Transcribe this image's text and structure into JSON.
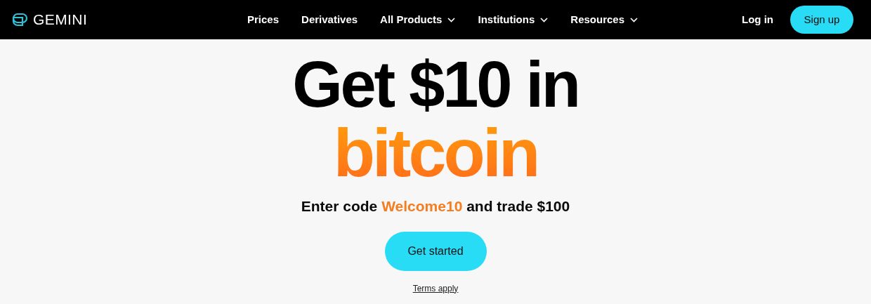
{
  "header": {
    "logo_text": "GEMINI",
    "nav": [
      {
        "label": "Prices",
        "has_menu": false
      },
      {
        "label": "Derivatives",
        "has_menu": false
      },
      {
        "label": "All Products",
        "has_menu": true
      },
      {
        "label": "Institutions",
        "has_menu": true
      },
      {
        "label": "Resources",
        "has_menu": true
      }
    ],
    "login": "Log in",
    "signup": "Sign up"
  },
  "hero": {
    "headline": "Get $10 in",
    "highlight": "bitcoin",
    "subtitle": "Enter code **Welcome10** and trade $100",
    "cta": "Get started",
    "terms": "Terms apply"
  }
}
